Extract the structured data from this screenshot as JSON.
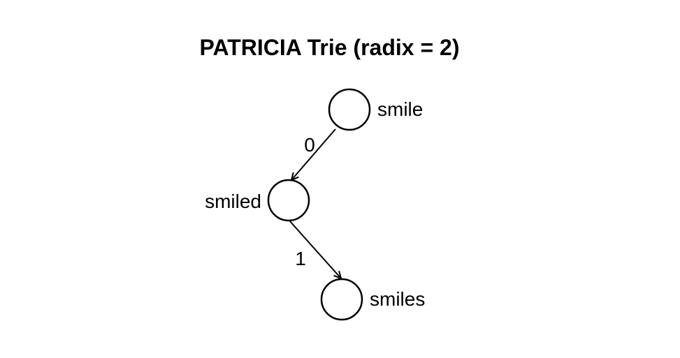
{
  "title": "PATRICIA Trie (radix = 2)",
  "nodes": [
    {
      "id": "root",
      "label": "smile"
    },
    {
      "id": "mid",
      "label": "smiled"
    },
    {
      "id": "leaf",
      "label": "smiles"
    }
  ],
  "edges": [
    {
      "from": "root",
      "to": "mid",
      "label": "0"
    },
    {
      "from": "mid",
      "to": "leaf",
      "label": "1"
    }
  ],
  "colors": {
    "stroke": "#000000",
    "text": "#000000",
    "background": "#ffffff"
  }
}
